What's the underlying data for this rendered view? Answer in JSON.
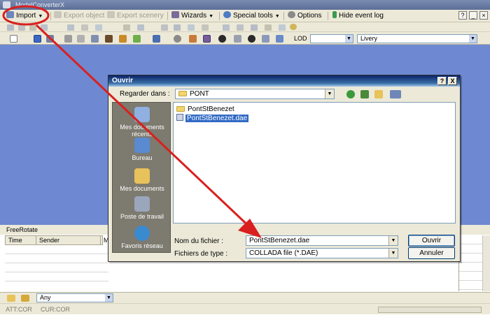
{
  "window": {
    "title": "ModelConverterX"
  },
  "menubar": {
    "import": "Import",
    "export_object": "Export object",
    "export_scenery": "Export scenery",
    "wizards": "Wizards",
    "special_tools": "Special tools",
    "options": "Options",
    "hide_event_log": "Hide event log"
  },
  "toolbar": {
    "lod_label": "LOD",
    "livery_value": "Livery"
  },
  "log": {
    "title": "FreeRotate",
    "columns": [
      "Time",
      "Sender",
      "M"
    ],
    "filter_value": "Any"
  },
  "status": {
    "att": "ATT:COR",
    "cur": "CUR:COR"
  },
  "dialog": {
    "title": "Ouvrir",
    "help": "?",
    "close": "X",
    "look_in_label": "Regarder dans :",
    "look_in_value": "PONT",
    "places": [
      "Mes documents récents",
      "Bureau",
      "Mes documents",
      "Poste de travail",
      "Favoris réseau"
    ],
    "files": [
      {
        "name": "PontStBenezet",
        "type": "folder"
      },
      {
        "name": "PontStBenezet.dae",
        "type": "file",
        "selected": true
      }
    ],
    "filename_label": "Nom du fichier :",
    "filename_value": "PontStBenezet.dae",
    "filetype_label": "Fichiers de type :",
    "filetype_value": "COLLADA file (*.DAE)",
    "open_button": "Ouvrir",
    "cancel_button": "Annuler"
  },
  "colors": {
    "annotation": "#d9201f",
    "viewport": "#6e89d2",
    "dialog_title": "#0a246a"
  }
}
